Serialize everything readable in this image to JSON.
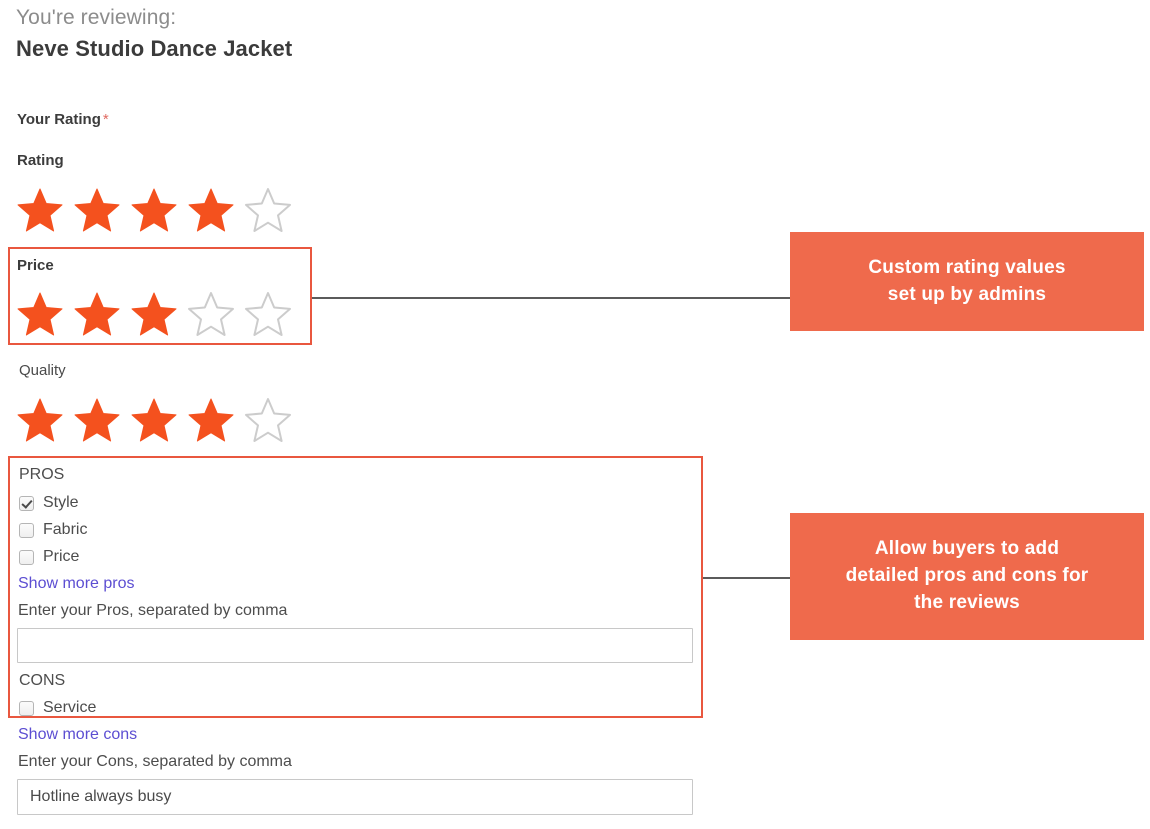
{
  "header": {
    "reviewing_label": "You're reviewing:",
    "product_title": "Neve Studio Dance Jacket"
  },
  "form": {
    "your_rating_label": "Your Rating",
    "required_marker": "*",
    "ratings": [
      {
        "name": "Rating",
        "label": "Rating",
        "value": 4,
        "max": 5,
        "highlighted": false
      },
      {
        "name": "Price",
        "label": "Price",
        "value": 3,
        "max": 5,
        "highlighted": true
      },
      {
        "name": "Quality",
        "label": "Quality",
        "value": 4,
        "max": 5,
        "highlighted": false
      }
    ],
    "pros": {
      "heading": "PROS",
      "options": [
        {
          "label": "Style",
          "checked": true
        },
        {
          "label": "Fabric",
          "checked": true
        },
        {
          "label": "Price",
          "checked": false
        }
      ],
      "show_more_link": "Show more pros",
      "input_label": "Enter your Pros, separated by comma",
      "input_value": "",
      "input_placeholder": ""
    },
    "cons": {
      "heading": "CONS",
      "options": [
        {
          "label": "Service",
          "checked": false
        }
      ],
      "show_more_link": "Show more cons",
      "input_label": "Enter your Cons, separated by comma",
      "input_value": "Hotline always busy",
      "input_placeholder": ""
    }
  },
  "annotations": [
    {
      "id": "rating-callout",
      "text": "Custom rating values\nset up by admins",
      "line1": "Custom rating values",
      "line2": "set up by admins"
    },
    {
      "id": "proscons-callout",
      "text": "Allow buyers to add detailed pros and cons for the reviews",
      "line1": "Allow buyers to add",
      "line2": "detailed pros and cons for",
      "line3": "the reviews"
    }
  ],
  "colors": {
    "star_filled": "#f4511e",
    "star_empty_stroke": "#cccccc",
    "callout_bg": "#ef6a4c",
    "highlight_border": "#e9573f",
    "link": "#5c4ed2",
    "required_asterisk": "#e06a61",
    "connector": "#5b5b5b"
  }
}
